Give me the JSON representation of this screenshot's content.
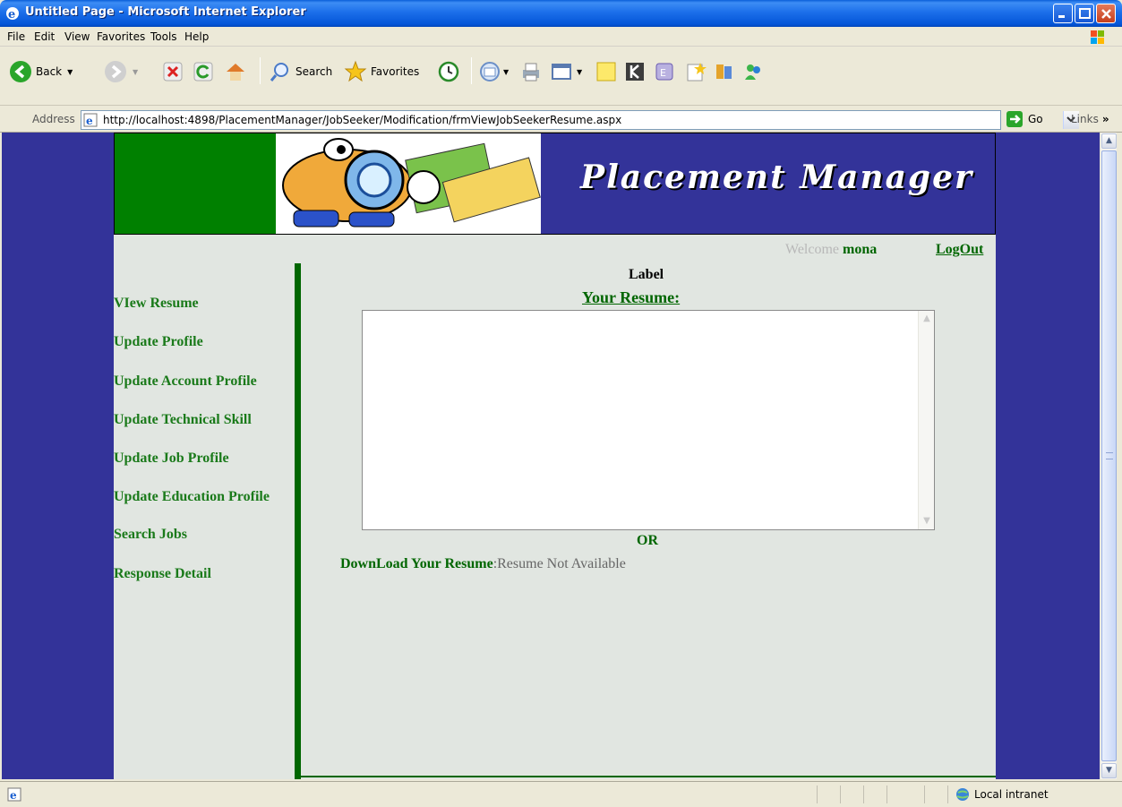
{
  "window": {
    "title": "Untitled Page - Microsoft Internet Explorer"
  },
  "menu": [
    "File",
    "Edit",
    "View",
    "Favorites",
    "Tools",
    "Help"
  ],
  "toolbar": {
    "back": "Back",
    "search": "Search",
    "favorites": "Favorites"
  },
  "address": {
    "label": "Address",
    "url": "http://localhost:4898/PlacementManager/JobSeeker/Modification/frmViewJobSeekerResume.aspx",
    "go": "Go",
    "links": "Links"
  },
  "site": {
    "brand": "Placement Manager",
    "welcome_prefix": "Welcome",
    "username": "mona",
    "logout": "LogOut",
    "nav": [
      "VIew Resume",
      "Update Profile",
      "Update Account Profile",
      "Update Technical Skill",
      "Update Job Profile",
      "Update Education Profile",
      "Search Jobs",
      "Response Detail"
    ],
    "label": "Label",
    "your_resume": "Your Resume:",
    "resume_text": "",
    "or": "OR",
    "download_label": "DownLoad Your Resume",
    "download_status": ":Resume Not Available"
  },
  "status": {
    "zone": "Local intranet"
  },
  "colors": {
    "site_bg": "#333399",
    "page_bg": "#e1e6e1",
    "accent_green": "#006600"
  }
}
